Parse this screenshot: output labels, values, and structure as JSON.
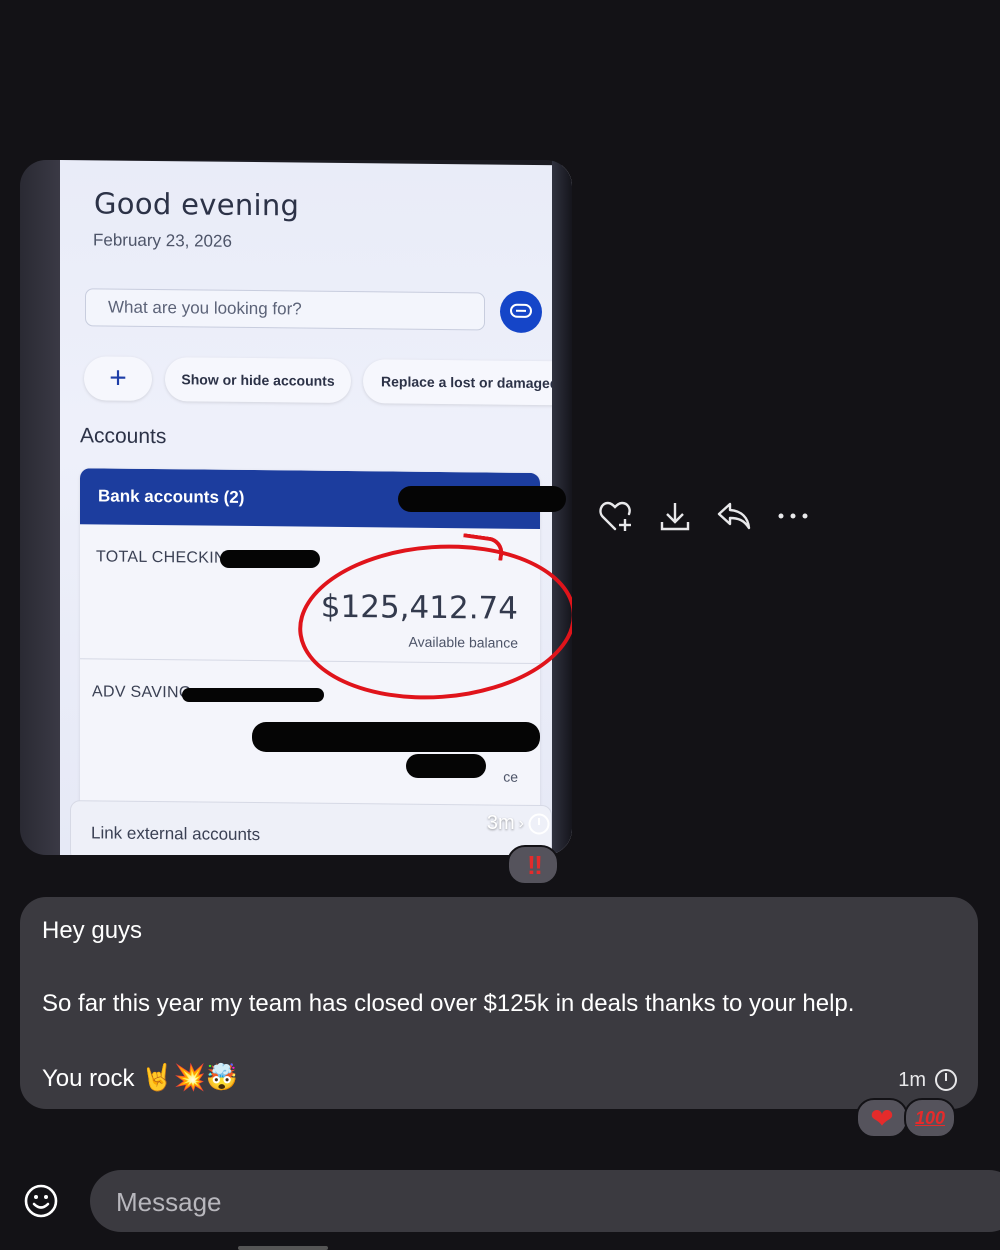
{
  "photo": {
    "greeting": "Good evening",
    "date": "February 23, 2026",
    "search_placeholder": "What are you looking for?",
    "chips": {
      "plus": "+",
      "show_hide": "Show or hide accounts",
      "replace": "Replace a lost or damaged"
    },
    "accounts_title": "Accounts",
    "bank_accounts_header": "Bank accounts (2)",
    "checking_label": "TOTAL CHECKIN",
    "checking_amount": "$125,412.74",
    "checking_amount_caption": "Available balance",
    "savings_label": "ADV SAVING",
    "savings_caption_fragment": "ce",
    "link_external": "Link external accounts",
    "timestamp": "3m"
  },
  "photo_reaction": "‼",
  "message_actions": [
    "add-reaction-icon",
    "download-icon",
    "reply-icon",
    "more-icon"
  ],
  "message": {
    "line1": "Hey guys",
    "line2": "So far this year my team has closed over $125k in deals thanks to your help.",
    "line3": "You rock",
    "line3_emojis": "🤘💥🤯",
    "timestamp": "1m"
  },
  "message_reactions": [
    "❤",
    "100"
  ],
  "composer": {
    "placeholder": "Message"
  },
  "colors": {
    "background": "#131216",
    "bubble": "#3b3a40",
    "bank_header": "#1c3d9e",
    "circle": "#e0141b"
  }
}
